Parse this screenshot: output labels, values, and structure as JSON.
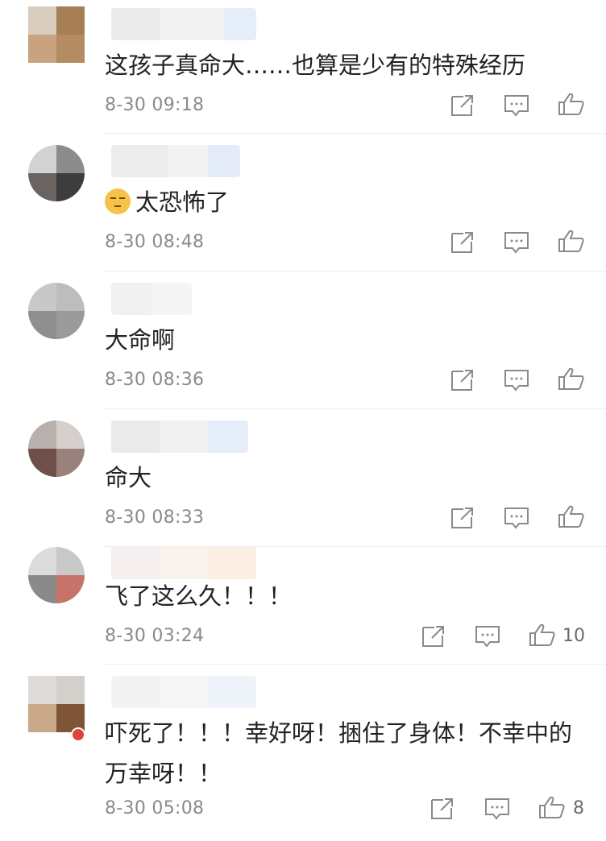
{
  "comments": [
    {
      "text": "这孩子真命大……也算是少有的特殊经历",
      "time": "8-30 09:18",
      "likes": ""
    },
    {
      "text": "太恐怖了",
      "time": "8-30 08:48",
      "likes": ""
    },
    {
      "text": "大命啊",
      "time": "8-30 08:36",
      "likes": ""
    },
    {
      "text": "命大",
      "time": "8-30 08:33",
      "likes": ""
    },
    {
      "text": "飞了这么久！！！",
      "time": "8-30 03:24",
      "likes": "10"
    },
    {
      "text": "吓死了！！！幸好呀！捆住了身体！不幸中的万幸呀！！",
      "time": "8-30 05:08",
      "likes": "8"
    }
  ],
  "icons": {
    "share": "share-icon",
    "reply": "comment-icon",
    "like": "thumbs-up-icon",
    "emoji": "emoji-sweat-icon"
  }
}
